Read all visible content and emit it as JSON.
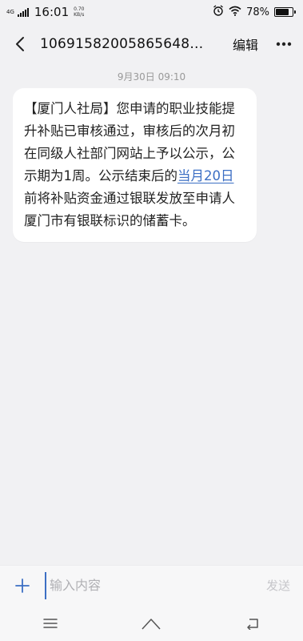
{
  "status_bar": {
    "network": "4G",
    "time": "16:01",
    "speed_value": "0.70",
    "speed_unit": "KB/s",
    "battery_percent_text": "78%",
    "battery_level": 0.78
  },
  "header": {
    "title": "10691582005865648…",
    "edit_label": "编辑"
  },
  "conversation": {
    "timestamp": "9月30日 09:10",
    "message_before_link": "【厦门人社局】您申请的职业技能提升补贴已审核通过，审核后的次月初在同级人社部门网站上予以公示，公示期为1周。公示结束后的",
    "message_link": "当月20日",
    "message_after_link": "前将补贴资金通过银联发放至申请人厦门市有银联标识的储蓄卡。"
  },
  "composer": {
    "placeholder": "输入内容",
    "value": "",
    "send_label": "发送"
  },
  "colors": {
    "link": "#3c6fc4",
    "background": "#f1f1f3",
    "bubble": "#ffffff"
  }
}
